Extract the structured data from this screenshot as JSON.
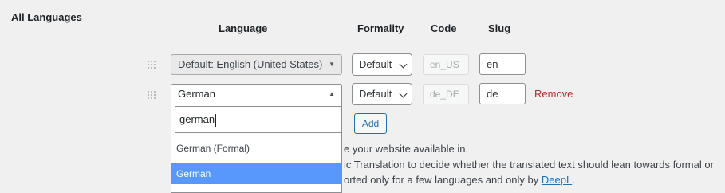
{
  "section": {
    "title": "All Languages"
  },
  "columns": {
    "language": "Language",
    "formality": "Formality",
    "code": "Code",
    "slug": "Slug"
  },
  "rows": [
    {
      "language": "Default: English (United States)",
      "formality": "Default",
      "code_placeholder": "en_US",
      "slug": "en"
    },
    {
      "language": "German",
      "formality": "Default",
      "code_placeholder": "de_DE",
      "slug": "de",
      "remove_label": "Remove"
    }
  ],
  "add_button": "Add",
  "dropdown": {
    "search_value": "german",
    "options": [
      {
        "label": "German (Formal)",
        "highlighted": false
      },
      {
        "label": "German",
        "highlighted": true
      }
    ]
  },
  "description": {
    "line1": "e your website available in.",
    "line2": "ic Translation to decide whether the translated text should lean towards formal or",
    "line3_prefix": "orted only for a few languages and only by ",
    "line3_link": "DeepL",
    "line3_suffix": "."
  },
  "colors": {
    "link": "#2271b1",
    "remove": "#b32d2e",
    "highlight": "#5897fb"
  },
  "icons": {
    "drag": "drag-handle-icon",
    "dropdown": "triangle-down-icon",
    "chevron": "chevron-down-icon"
  }
}
